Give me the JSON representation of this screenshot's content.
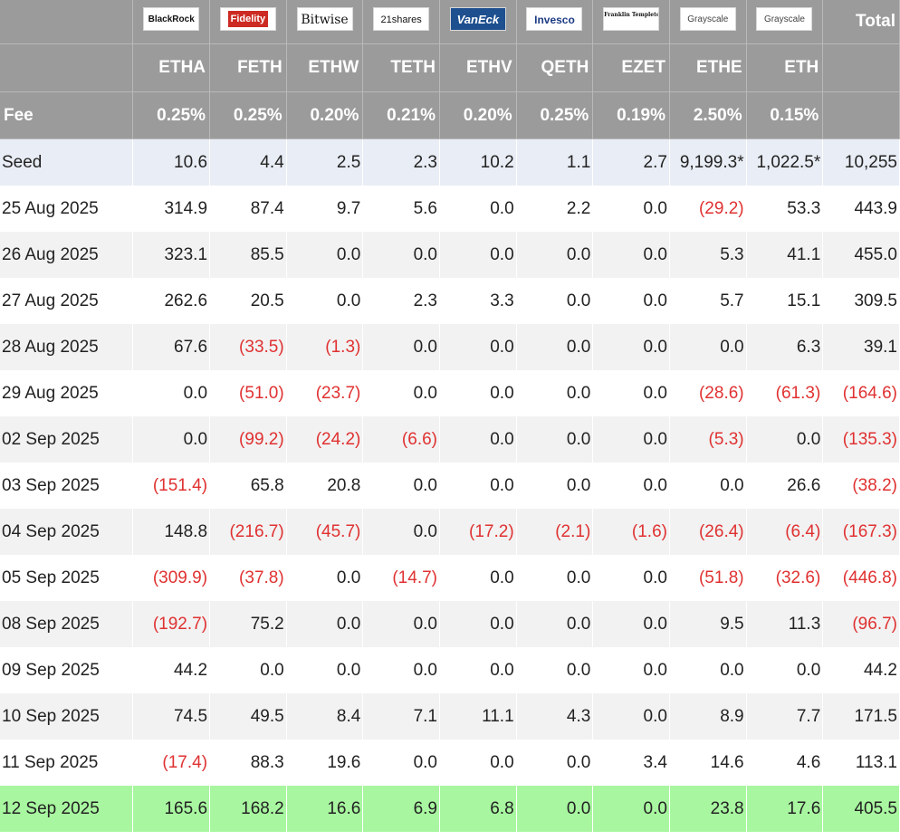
{
  "chart_data": {
    "type": "table",
    "issuers": [
      "BlackRock",
      "Fidelity",
      "Bitwise",
      "21shares",
      "VanEck",
      "Invesco",
      "Franklin Templeton",
      "Grayscale",
      "Grayscale"
    ],
    "total_label": "Total",
    "tickers": [
      "ETHA",
      "FETH",
      "ETHW",
      "TETH",
      "ETHV",
      "QETH",
      "EZET",
      "ETHE",
      "ETH"
    ],
    "fee_label": "Fee",
    "fees": [
      "0.25%",
      "0.25%",
      "0.20%",
      "0.21%",
      "0.20%",
      "0.25%",
      "0.19%",
      "2.50%",
      "0.15%"
    ],
    "rows": [
      {
        "label": "Seed",
        "values": [
          "10.6",
          "4.4",
          "2.5",
          "2.3",
          "10.2",
          "1.1",
          "2.7",
          "9,199.3*",
          "1,022.5*",
          "10,255"
        ]
      },
      {
        "label": "25 Aug 2025",
        "values": [
          "314.9",
          "87.4",
          "9.7",
          "5.6",
          "0.0",
          "2.2",
          "0.0",
          "(29.2)",
          "53.3",
          "443.9"
        ]
      },
      {
        "label": "26 Aug 2025",
        "values": [
          "323.1",
          "85.5",
          "0.0",
          "0.0",
          "0.0",
          "0.0",
          "0.0",
          "5.3",
          "41.1",
          "455.0"
        ]
      },
      {
        "label": "27 Aug 2025",
        "values": [
          "262.6",
          "20.5",
          "0.0",
          "2.3",
          "3.3",
          "0.0",
          "0.0",
          "5.7",
          "15.1",
          "309.5"
        ]
      },
      {
        "label": "28 Aug 2025",
        "values": [
          "67.6",
          "(33.5)",
          "(1.3)",
          "0.0",
          "0.0",
          "0.0",
          "0.0",
          "0.0",
          "6.3",
          "39.1"
        ]
      },
      {
        "label": "29 Aug 2025",
        "values": [
          "0.0",
          "(51.0)",
          "(23.7)",
          "0.0",
          "0.0",
          "0.0",
          "0.0",
          "(28.6)",
          "(61.3)",
          "(164.6)"
        ]
      },
      {
        "label": "02 Sep 2025",
        "values": [
          "0.0",
          "(99.2)",
          "(24.2)",
          "(6.6)",
          "0.0",
          "0.0",
          "0.0",
          "(5.3)",
          "0.0",
          "(135.3)"
        ]
      },
      {
        "label": "03 Sep 2025",
        "values": [
          "(151.4)",
          "65.8",
          "20.8",
          "0.0",
          "0.0",
          "0.0",
          "0.0",
          "0.0",
          "26.6",
          "(38.2)"
        ]
      },
      {
        "label": "04 Sep 2025",
        "values": [
          "148.8",
          "(216.7)",
          "(45.7)",
          "0.0",
          "(17.2)",
          "(2.1)",
          "(1.6)",
          "(26.4)",
          "(6.4)",
          "(167.3)"
        ]
      },
      {
        "label": "05 Sep 2025",
        "values": [
          "(309.9)",
          "(37.8)",
          "0.0",
          "(14.7)",
          "0.0",
          "0.0",
          "0.0",
          "(51.8)",
          "(32.6)",
          "(446.8)"
        ]
      },
      {
        "label": "08 Sep 2025",
        "values": [
          "(192.7)",
          "75.2",
          "0.0",
          "0.0",
          "0.0",
          "0.0",
          "0.0",
          "9.5",
          "11.3",
          "(96.7)"
        ]
      },
      {
        "label": "09 Sep 2025",
        "values": [
          "44.2",
          "0.0",
          "0.0",
          "0.0",
          "0.0",
          "0.0",
          "0.0",
          "0.0",
          "0.0",
          "44.2"
        ]
      },
      {
        "label": "10 Sep 2025",
        "values": [
          "74.5",
          "49.5",
          "8.4",
          "7.1",
          "11.1",
          "4.3",
          "0.0",
          "8.9",
          "7.7",
          "171.5"
        ]
      },
      {
        "label": "11 Sep 2025",
        "values": [
          "(17.4)",
          "88.3",
          "19.6",
          "0.0",
          "0.0",
          "0.0",
          "3.4",
          "14.6",
          "4.6",
          "113.1"
        ]
      },
      {
        "label": "12 Sep 2025",
        "values": [
          "165.6",
          "168.2",
          "16.6",
          "6.9",
          "6.8",
          "0.0",
          "0.0",
          "23.8",
          "17.6",
          "405.5"
        ]
      }
    ]
  },
  "colors": {
    "header_bg": "#9b9b9b",
    "seed_row_bg": "#e9edf5",
    "alt_row_bg": "#f2f2f2",
    "latest_row_bg": "#a8f7a0",
    "negative_text": "#e03131"
  }
}
